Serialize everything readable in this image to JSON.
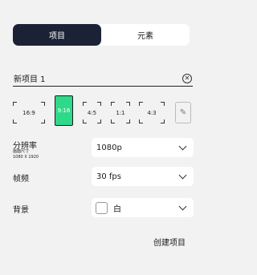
{
  "tabs": [
    {
      "label": "项目",
      "active": true
    },
    {
      "label": "元素",
      "active": false
    }
  ],
  "project_name": {
    "value": "新项目 1",
    "clear_icon": "close-circle-icon"
  },
  "aspect_ratios": [
    {
      "label": "16:9",
      "selected": false
    },
    {
      "label": "9:16",
      "selected": true
    },
    {
      "label": "4:5",
      "selected": false
    },
    {
      "label": "1:1",
      "selected": false
    },
    {
      "label": "4:3",
      "selected": false
    }
  ],
  "edit_ratio_icon": "pencil-icon",
  "resolution": {
    "label": "分辨率",
    "sub_label_1": "画面尺寸",
    "sub_label_2": "1080 X 1920",
    "value": "1080p"
  },
  "frame_rate": {
    "label": "帧频",
    "value": "30 fps"
  },
  "background": {
    "label": "背景",
    "value": "白",
    "color": "#ffffff"
  },
  "create_button": {
    "label": "创建项目"
  },
  "colors": {
    "accent": "#2fd98a",
    "tab_active": "#1c2236"
  }
}
